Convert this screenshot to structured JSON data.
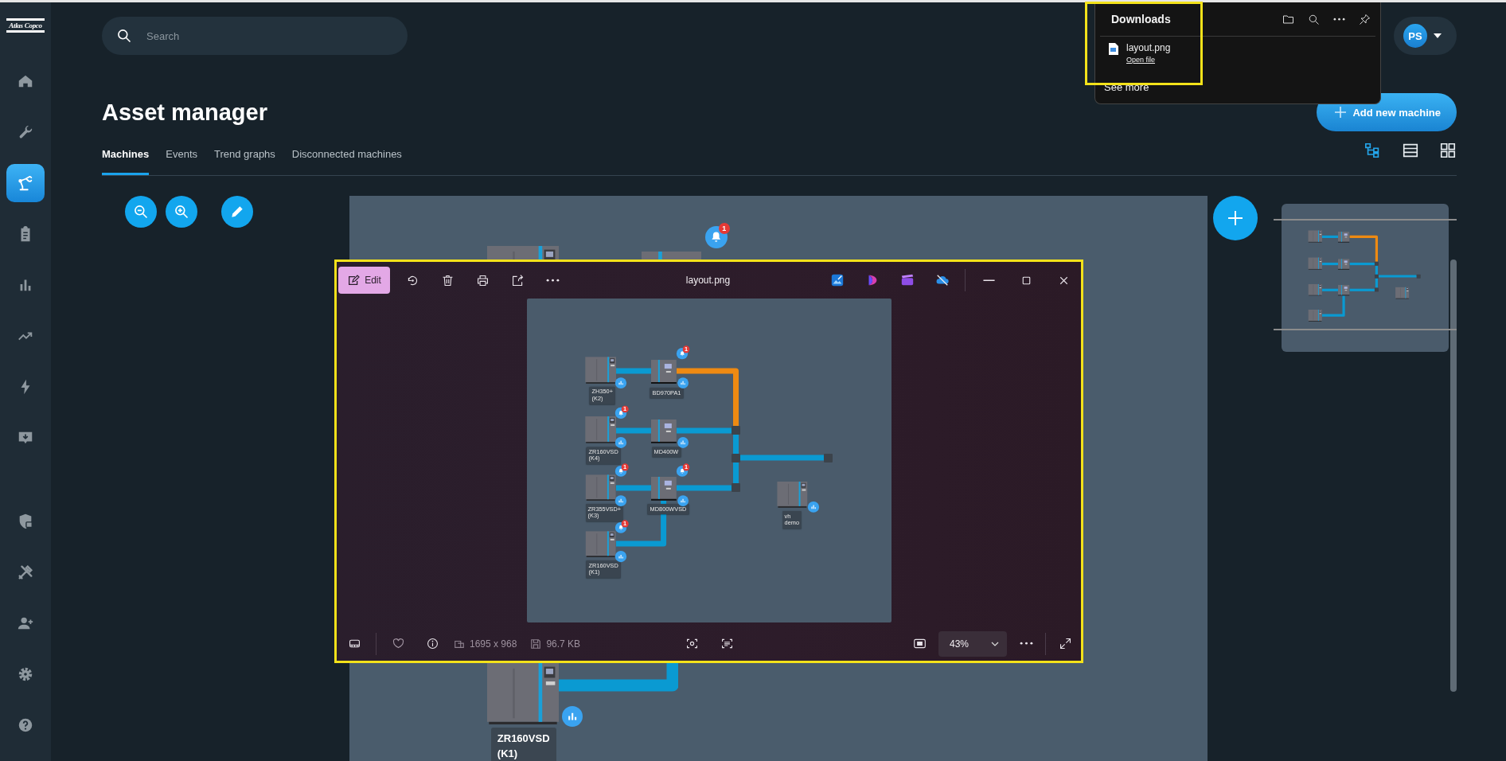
{
  "logo": "Atlas Copco",
  "sidebar": {
    "items": [
      {
        "selected": false
      },
      {
        "selected": false
      },
      {
        "selected": true
      },
      {
        "selected": false
      },
      {
        "selected": false
      },
      {
        "selected": false
      },
      {
        "selected": false
      },
      {
        "selected": false
      },
      {
        "selected": false
      },
      {
        "selected": false
      },
      {
        "selected": false
      },
      {
        "selected": false
      },
      {
        "selected": false
      }
    ]
  },
  "search": {
    "placeholder": "Search"
  },
  "user": {
    "initials": "PS"
  },
  "page": {
    "title": "Asset manager",
    "add_button": "Add new machine"
  },
  "tabs": [
    {
      "label": "Machines",
      "selected": true
    },
    {
      "label": "Events",
      "selected": false
    },
    {
      "label": "Trend graphs",
      "selected": false
    },
    {
      "label": "Disconnected machines",
      "selected": false
    }
  ],
  "views": [
    {
      "selected": true
    },
    {
      "selected": false
    },
    {
      "selected": false
    }
  ],
  "canvas": {
    "alarm_badge": "1",
    "machine_label": "ZR160VSD (K1)"
  },
  "photo_viewer": {
    "edit_button": "Edit",
    "file_name": "layout.png",
    "dimensions": "1695 x 968",
    "file_size": "96.7 KB",
    "zoom": "43%",
    "image": {
      "machines": [
        {
          "kind": "compressor",
          "label": "ZH350+ (K2)"
        },
        {
          "kind": "dryer",
          "label": "BD970PA1",
          "alarm": "1"
        },
        {
          "kind": "compressor",
          "label": "ZR160VSD (K4)",
          "alarm": "1"
        },
        {
          "kind": "dryer",
          "label": "MD400W"
        },
        {
          "kind": "compressor",
          "label": "ZR355VSD+ (K3)",
          "alarm": "1"
        },
        {
          "kind": "dryer",
          "label": "MD800WVSD",
          "alarm": "1"
        },
        {
          "kind": "compressor",
          "label": "ZR160VSD (K1)",
          "alarm": "1"
        },
        {
          "kind": "compressor",
          "label": "vh demo"
        }
      ]
    }
  },
  "downloads": {
    "title": "Downloads",
    "files": [
      {
        "name": "layout.png",
        "action": "Open file"
      }
    ],
    "see_more": "See more"
  }
}
